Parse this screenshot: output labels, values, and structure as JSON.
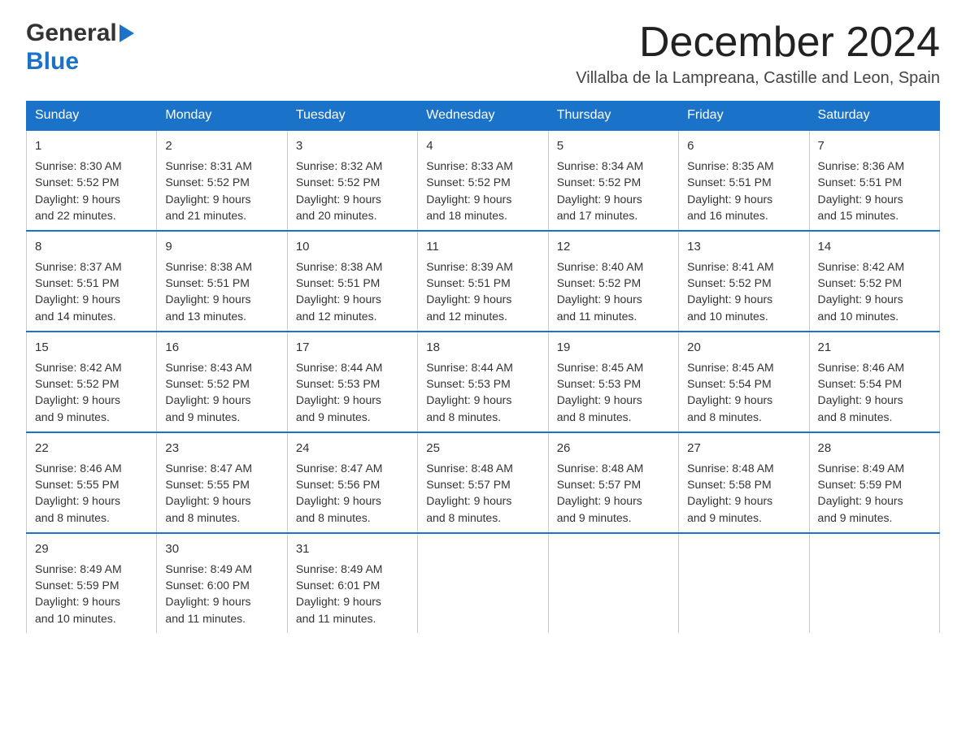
{
  "logo": {
    "general": "General",
    "blue": "Blue",
    "arrow_color": "#1a73c8"
  },
  "title": "December 2024",
  "subtitle": "Villalba de la Lampreana, Castille and Leon, Spain",
  "days_of_week": [
    "Sunday",
    "Monday",
    "Tuesday",
    "Wednesday",
    "Thursday",
    "Friday",
    "Saturday"
  ],
  "weeks": [
    [
      {
        "day": "1",
        "sunrise": "8:30 AM",
        "sunset": "5:52 PM",
        "daylight": "9 hours and 22 minutes."
      },
      {
        "day": "2",
        "sunrise": "8:31 AM",
        "sunset": "5:52 PM",
        "daylight": "9 hours and 21 minutes."
      },
      {
        "day": "3",
        "sunrise": "8:32 AM",
        "sunset": "5:52 PM",
        "daylight": "9 hours and 20 minutes."
      },
      {
        "day": "4",
        "sunrise": "8:33 AM",
        "sunset": "5:52 PM",
        "daylight": "9 hours and 18 minutes."
      },
      {
        "day": "5",
        "sunrise": "8:34 AM",
        "sunset": "5:52 PM",
        "daylight": "9 hours and 17 minutes."
      },
      {
        "day": "6",
        "sunrise": "8:35 AM",
        "sunset": "5:51 PM",
        "daylight": "9 hours and 16 minutes."
      },
      {
        "day": "7",
        "sunrise": "8:36 AM",
        "sunset": "5:51 PM",
        "daylight": "9 hours and 15 minutes."
      }
    ],
    [
      {
        "day": "8",
        "sunrise": "8:37 AM",
        "sunset": "5:51 PM",
        "daylight": "9 hours and 14 minutes."
      },
      {
        "day": "9",
        "sunrise": "8:38 AM",
        "sunset": "5:51 PM",
        "daylight": "9 hours and 13 minutes."
      },
      {
        "day": "10",
        "sunrise": "8:38 AM",
        "sunset": "5:51 PM",
        "daylight": "9 hours and 12 minutes."
      },
      {
        "day": "11",
        "sunrise": "8:39 AM",
        "sunset": "5:51 PM",
        "daylight": "9 hours and 12 minutes."
      },
      {
        "day": "12",
        "sunrise": "8:40 AM",
        "sunset": "5:52 PM",
        "daylight": "9 hours and 11 minutes."
      },
      {
        "day": "13",
        "sunrise": "8:41 AM",
        "sunset": "5:52 PM",
        "daylight": "9 hours and 10 minutes."
      },
      {
        "day": "14",
        "sunrise": "8:42 AM",
        "sunset": "5:52 PM",
        "daylight": "9 hours and 10 minutes."
      }
    ],
    [
      {
        "day": "15",
        "sunrise": "8:42 AM",
        "sunset": "5:52 PM",
        "daylight": "9 hours and 9 minutes."
      },
      {
        "day": "16",
        "sunrise": "8:43 AM",
        "sunset": "5:52 PM",
        "daylight": "9 hours and 9 minutes."
      },
      {
        "day": "17",
        "sunrise": "8:44 AM",
        "sunset": "5:53 PM",
        "daylight": "9 hours and 9 minutes."
      },
      {
        "day": "18",
        "sunrise": "8:44 AM",
        "sunset": "5:53 PM",
        "daylight": "9 hours and 8 minutes."
      },
      {
        "day": "19",
        "sunrise": "8:45 AM",
        "sunset": "5:53 PM",
        "daylight": "9 hours and 8 minutes."
      },
      {
        "day": "20",
        "sunrise": "8:45 AM",
        "sunset": "5:54 PM",
        "daylight": "9 hours and 8 minutes."
      },
      {
        "day": "21",
        "sunrise": "8:46 AM",
        "sunset": "5:54 PM",
        "daylight": "9 hours and 8 minutes."
      }
    ],
    [
      {
        "day": "22",
        "sunrise": "8:46 AM",
        "sunset": "5:55 PM",
        "daylight": "9 hours and 8 minutes."
      },
      {
        "day": "23",
        "sunrise": "8:47 AM",
        "sunset": "5:55 PM",
        "daylight": "9 hours and 8 minutes."
      },
      {
        "day": "24",
        "sunrise": "8:47 AM",
        "sunset": "5:56 PM",
        "daylight": "9 hours and 8 minutes."
      },
      {
        "day": "25",
        "sunrise": "8:48 AM",
        "sunset": "5:57 PM",
        "daylight": "9 hours and 8 minutes."
      },
      {
        "day": "26",
        "sunrise": "8:48 AM",
        "sunset": "5:57 PM",
        "daylight": "9 hours and 9 minutes."
      },
      {
        "day": "27",
        "sunrise": "8:48 AM",
        "sunset": "5:58 PM",
        "daylight": "9 hours and 9 minutes."
      },
      {
        "day": "28",
        "sunrise": "8:49 AM",
        "sunset": "5:59 PM",
        "daylight": "9 hours and 9 minutes."
      }
    ],
    [
      {
        "day": "29",
        "sunrise": "8:49 AM",
        "sunset": "5:59 PM",
        "daylight": "9 hours and 10 minutes."
      },
      {
        "day": "30",
        "sunrise": "8:49 AM",
        "sunset": "6:00 PM",
        "daylight": "9 hours and 11 minutes."
      },
      {
        "day": "31",
        "sunrise": "8:49 AM",
        "sunset": "6:01 PM",
        "daylight": "9 hours and 11 minutes."
      },
      null,
      null,
      null,
      null
    ]
  ],
  "cell_labels": {
    "sunrise": "Sunrise: ",
    "sunset": "Sunset: ",
    "daylight": "Daylight: "
  }
}
